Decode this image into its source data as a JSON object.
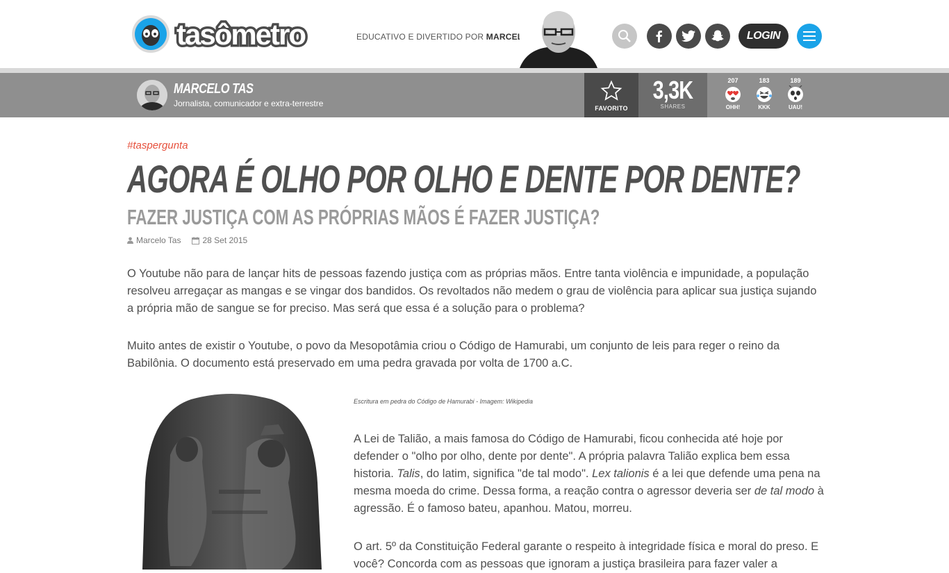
{
  "header": {
    "logo_text": "tasômetro",
    "tagline_prefix": "EDUCATIVO E DIVERTIDO POR",
    "tagline_name": "MARCELO TAS",
    "login_label": "LOGIN"
  },
  "author_bar": {
    "name": "MARCELO TAS",
    "description": "Jornalista, comunicador e extra-terrestre",
    "favorite_label": "FAVORITO",
    "shares_count": "3,3K",
    "shares_label": "SHARES",
    "reactions": [
      {
        "count": "207",
        "label": "OHH!"
      },
      {
        "count": "183",
        "label": "KKK"
      },
      {
        "count": "189",
        "label": "UAU!"
      }
    ]
  },
  "article": {
    "hashtag": "#taspergunta",
    "title": "AGORA É OLHO POR OLHO E DENTE POR DENTE?",
    "subtitle": "FAZER JUSTIÇA COM AS PRÓPRIAS MÃOS É FAZER JUSTIÇA?",
    "author": "Marcelo Tas",
    "date": "28 Set 2015",
    "paragraph1": "O Youtube não para de lançar hits de pessoas fazendo justiça com as próprias mãos. Entre tanta violência e impunidade, a população resolveu arregaçar as mangas e se vingar dos bandidos. Os revoltados não medem o grau de violência para aplicar sua justiça sujando a própria mão de sangue se for preciso. Mas será que essa é a solução para o problema?",
    "paragraph2": "Muito antes de existir o Youtube, o povo da Mesopotâmia criou o Código de Hamurabi, um conjunto de leis para reger o reino da Babilônia. O documento está preservado em uma pedra gravada por volta de 1700 a.C.",
    "image_caption": "Escritura em pedra do Código de Hamurabi - Imagem: Wikipedia",
    "paragraph3_a": "A Lei de Talião, a mais famosa do Código de Hamurabi, ficou conhecida até hoje por defender o \"olho por olho, dente por dente\". A própria palavra Talião explica bem essa historia. ",
    "paragraph3_talis": "Talis",
    "paragraph3_b": ", do latim, significa \"de tal modo\". ",
    "paragraph3_lex": "Lex talionis",
    "paragraph3_c": " é a lei que defende uma pena na mesma moeda do crime. Dessa forma, a reação contra o agressor deveria ser ",
    "paragraph3_detal": "de tal modo",
    "paragraph3_d": " à agressão. É o famoso bateu, apanhou. Matou, morreu.",
    "paragraph4": "O art. 5º da Constituição Federal garante o respeito à integridade física e moral do preso. E você? Concorda com as pessoas que ignoram a justiça brasileira para fazer valer a"
  },
  "colors": {
    "accent_blue": "#1aa3e8",
    "hashtag_red": "#e6503c",
    "bar_gray": "#8f8f8f",
    "dark_gray": "#4a4a4a"
  }
}
